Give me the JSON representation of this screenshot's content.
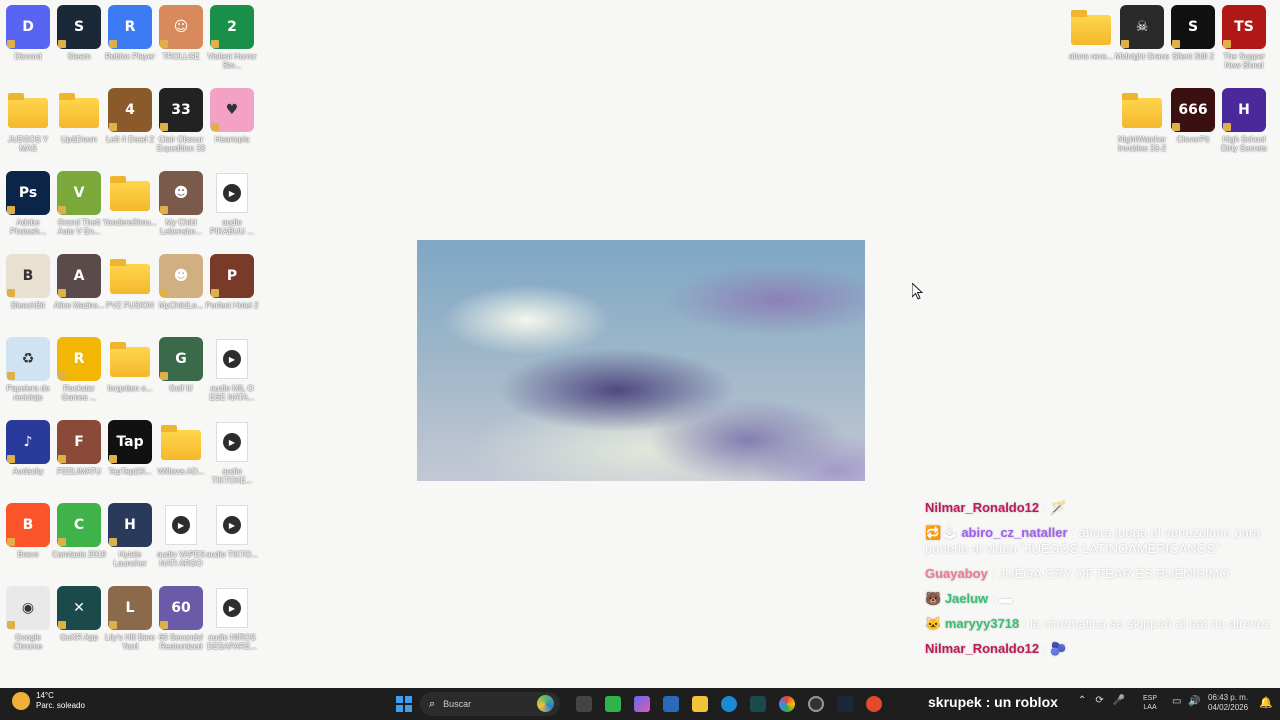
{
  "desktop_left": [
    {
      "label": "Discord",
      "kind": "app",
      "color": "#5865f2",
      "glyph": "D"
    },
    {
      "label": "Steam",
      "kind": "app",
      "color": "#1b2838",
      "glyph": "S"
    },
    {
      "label": "Roblox Player",
      "kind": "app",
      "color": "#3b7cf5",
      "glyph": "R"
    },
    {
      "label": "TROLLGE",
      "kind": "app",
      "color": "#d88a5c",
      "glyph": "☺"
    },
    {
      "label": "Violent Horror Sto...",
      "kind": "app",
      "color": "#1a8f4a",
      "glyph": "2"
    },
    {
      "label": "JUEGOS Y MAS",
      "kind": "folder"
    },
    {
      "label": "Up&Down",
      "kind": "folder"
    },
    {
      "label": "Left 4 Dead 2",
      "kind": "app",
      "color": "#8a5a2a",
      "glyph": "4"
    },
    {
      "label": "Clair Obscur Expedition 33",
      "kind": "app",
      "color": "#222",
      "glyph": "33"
    },
    {
      "label": "Heartopia",
      "kind": "app",
      "color": "#f3a1c4",
      "glyph": "♥"
    },
    {
      "label": "Adobe Photosh...",
      "kind": "app",
      "color": "#0b2548",
      "glyph": "Ps"
    },
    {
      "label": "Grand Theft Auto V En...",
      "kind": "app",
      "color": "#7aa83a",
      "glyph": "V"
    },
    {
      "label": "YandereSimu...",
      "kind": "folder"
    },
    {
      "label": "My Child Lebensbo...",
      "kind": "app",
      "color": "#7a5a4a",
      "glyph": "☻"
    },
    {
      "label": "audio PIKABUU ...",
      "kind": "audio"
    },
    {
      "label": "BleachBit",
      "kind": "app",
      "color": "#e8e0d0",
      "glyph": "B"
    },
    {
      "label": "Alice Madne...",
      "kind": "app",
      "color": "#5a4a4a",
      "glyph": "A"
    },
    {
      "label": "PVZ FUSION",
      "kind": "folder"
    },
    {
      "label": "MyChildLe...",
      "kind": "app",
      "color": "#d0b080",
      "glyph": "☻"
    },
    {
      "label": "Perfect Hotel 2",
      "kind": "app",
      "color": "#7a3a2a",
      "glyph": "P"
    },
    {
      "label": "Papelera de reciclaje",
      "kind": "app",
      "color": "#cfe3f2",
      "glyph": "♻"
    },
    {
      "label": "Rockstar Games ...",
      "kind": "app",
      "color": "#f2b705",
      "glyph": "R"
    },
    {
      "label": "forgotten o...",
      "kind": "folder"
    },
    {
      "label": "Golf It!",
      "kind": "app",
      "color": "#3a6a4a",
      "glyph": "G"
    },
    {
      "label": "audio MIL O ESE NATA...",
      "kind": "audio"
    },
    {
      "label": "Audacity",
      "kind": "app",
      "color": "#2a3a9a",
      "glyph": "♪"
    },
    {
      "label": "FEELIMATU",
      "kind": "app",
      "color": "#8a4a3a",
      "glyph": "F"
    },
    {
      "label": "TapTap(Gl...",
      "kind": "app",
      "color": "#111",
      "glyph": "Tap"
    },
    {
      "label": "Willows AD...",
      "kind": "folder"
    },
    {
      "label": "audio TIKTOKE...",
      "kind": "audio"
    },
    {
      "label": "Brave",
      "kind": "app",
      "color": "#fb542b",
      "glyph": "B"
    },
    {
      "label": "Camtasia 2019",
      "kind": "app",
      "color": "#3fb34a",
      "glyph": "C"
    },
    {
      "label": "Hytale Launcher",
      "kind": "app",
      "color": "#2a3a5a",
      "glyph": "H"
    },
    {
      "label": "audio VAPES NATI ARGO",
      "kind": "audio"
    },
    {
      "label": "audio TIKTO...",
      "kind": "audio"
    },
    {
      "label": "Google Chrome",
      "kind": "app",
      "color": "#e9e9e9",
      "glyph": "◉"
    },
    {
      "label": "GoXR App",
      "kind": "app",
      "color": "#1a4a4a",
      "glyph": "✕"
    },
    {
      "label": "Lily's Hill Bare Yard",
      "kind": "app",
      "color": "#8a6a4a",
      "glyph": "L"
    },
    {
      "label": "60 Seconds! Reatomized",
      "kind": "app",
      "color": "#6a5aa8",
      "glyph": "60"
    },
    {
      "label": "audio NIÑOS DESAPARE...",
      "kind": "audio"
    }
  ],
  "desktop_right": [
    {
      "label": "afons reve...",
      "kind": "folder"
    },
    {
      "label": "Midnight Grane",
      "kind": "app",
      "color": "#2a2a2a",
      "glyph": "☠"
    },
    {
      "label": "Silent Still 2",
      "kind": "app",
      "color": "#111",
      "glyph": "S"
    },
    {
      "label": "The Supper New Blood",
      "kind": "app",
      "color": "#b01818",
      "glyph": "TS"
    },
    {
      "label": "NightWatcher Invobles 33-2",
      "kind": "folder"
    },
    {
      "label": "CloverPit",
      "kind": "app",
      "color": "#3a1010",
      "glyph": "666"
    },
    {
      "label": "High School Dirty Secrets",
      "kind": "app",
      "color": "#4a2a9a",
      "glyph": "H"
    }
  ],
  "chat": [
    {
      "user": "Nilmar_Ronaldo12",
      "user_color": "#c0185a",
      "msg": "",
      "emote": "🪄"
    },
    {
      "user": "abiro_cz_nataller",
      "user_color": "#a060f0",
      "msg": "ahora juega el venezolano para ponerle al video \"JUEGOS LATINOAMÉRICANOS\"",
      "badges": "🔁🕹"
    },
    {
      "user": "Guayaboy",
      "user_color": "#f07890",
      "msg": "JUEGA CRY OF FEAR ES BUENISIMO"
    },
    {
      "user": "Jaeluw",
      "user_color": "#38c070",
      "msg": "",
      "badges": "🐻",
      "emote": "▬"
    },
    {
      "user": "maryyy3718",
      "user_color": "#38c070",
      "msg": "la cinematica se skippeó al nat no alrevez",
      "badges": "🐱"
    },
    {
      "user": "Nilmar_Ronaldo12",
      "user_color": "#c0185a",
      "msg": "",
      "emote": "🫐"
    }
  ],
  "taskbar": {
    "weather_temp": "14°C",
    "weather_desc": "Parc. soleado",
    "search_placeholder": "Buscar",
    "streamer_label": "skrupek : un roblox",
    "lang_line1": "ESP",
    "lang_line2": "LAA",
    "time": "06:43 p. m.",
    "date": "04/02/2026"
  }
}
